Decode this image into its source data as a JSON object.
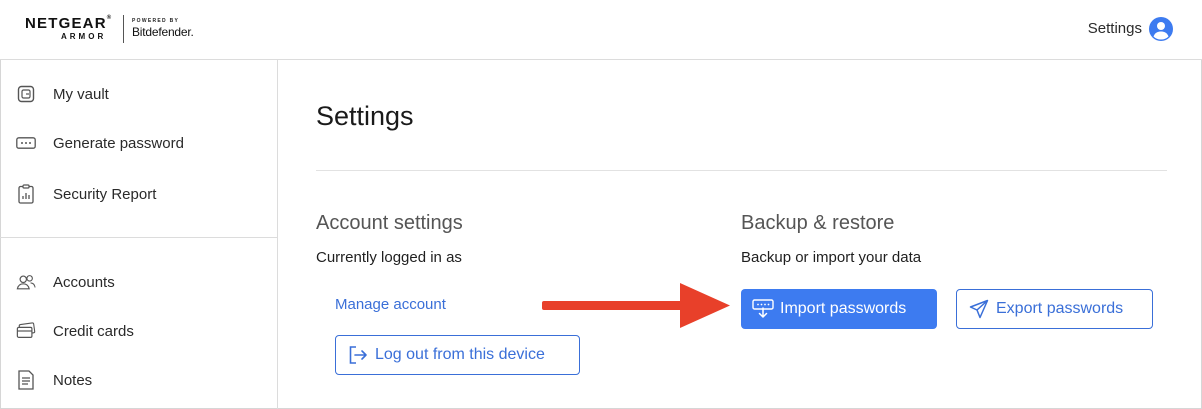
{
  "header": {
    "brand_netgear": "NETGEAR",
    "brand_tm": "®",
    "brand_armor": "ARMOR",
    "brand_powered": "POWERED BY",
    "brand_bitdefender": "Bitdefender.",
    "settings_label": "Settings",
    "user_icon": "user-circle-icon"
  },
  "sidebar": {
    "items": [
      {
        "label": "My vault",
        "icon": "vault-icon"
      },
      {
        "label": "Generate password",
        "icon": "password-dots-icon"
      },
      {
        "label": "Security Report",
        "icon": "clipboard-report-icon"
      },
      {
        "label": "Accounts",
        "icon": "accounts-users-icon"
      },
      {
        "label": "Credit cards",
        "icon": "credit-card-icon"
      },
      {
        "label": "Notes",
        "icon": "note-icon"
      }
    ]
  },
  "main": {
    "title": "Settings",
    "account": {
      "title": "Account settings",
      "subtitle": "Currently logged in as",
      "manage_link": "Manage account",
      "logout_label": "Log out from this device",
      "logout_icon": "logout-icon"
    },
    "backup": {
      "title": "Backup & restore",
      "subtitle": "Backup or import your data",
      "import_label": "Import passwords",
      "import_icon": "import-icon",
      "export_label": "Export passwords",
      "export_icon": "paper-plane-icon"
    }
  },
  "colors": {
    "accent": "#3d7bf0",
    "link": "#3a6fd8",
    "annotation_arrow": "#e8402a"
  }
}
